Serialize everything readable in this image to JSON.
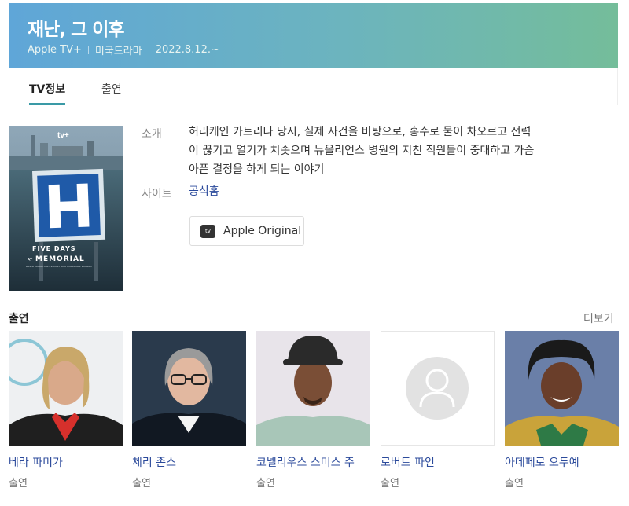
{
  "header": {
    "title": "재난, 그 이후",
    "meta": [
      "Apple TV+",
      "미국드라마",
      "2022.8.12.~"
    ]
  },
  "tabs": [
    {
      "label": "TV정보"
    },
    {
      "label": "출연"
    }
  ],
  "poster": {
    "brand": "tv+",
    "sign_letter": "H",
    "title_line1": "FIVE DAYS",
    "title_line2": "MEMORIAL",
    "title_small": "AT",
    "tagline": "BASED ON ACTUAL EVENTS FROM HURRICANE KATRINA"
  },
  "info": {
    "synopsis_label": "소개",
    "synopsis_lines": [
      "허리케인 카트리나 당시, 실제 사건을 바탕으로, 홍수로 물이 차오르고 전력",
      "이 끊기고 열기가 치솟으며 뉴올리언스 병원의 지친 직원들이 중대하고 가슴",
      "아픈 결정을 하게 되는 이야기"
    ],
    "site_label": "사이트",
    "site_link": "공식홈",
    "apple_logo_text": "tv",
    "apple_button": "Apple Original"
  },
  "cast": {
    "title": "출연",
    "more": "더보기",
    "members": [
      {
        "name": "베라 파미가",
        "role": "출연"
      },
      {
        "name": "체리 존스",
        "role": "출연"
      },
      {
        "name": "코넬리우스 스미스 주",
        "role": "출연"
      },
      {
        "name": "로버트 파인",
        "role": "출연"
      },
      {
        "name": "아데페로 오두예",
        "role": "출연"
      }
    ]
  },
  "colors": {
    "accent": "#3a9aa6",
    "link": "#2b4a9b"
  }
}
